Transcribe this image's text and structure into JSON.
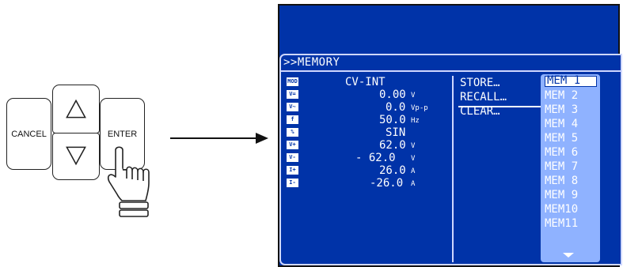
{
  "keypad": {
    "cancel_label": "CANCEL",
    "enter_label": "ENTER",
    "up_icon": "up-triangle-icon",
    "down_icon": "down-triangle-icon",
    "pointer_icon": "pointing-hand-icon"
  },
  "arrow_icon": "right-arrow-icon",
  "lcd": {
    "menu_title": ">>MEMORY",
    "params": [
      {
        "icon": "MOD",
        "value": "CV-INT",
        "unit": ""
      },
      {
        "icon": "V=",
        "value": "0.00",
        "unit": "V"
      },
      {
        "icon": "V~",
        "value": "0.0",
        "unit": "Vp-p"
      },
      {
        "icon": "f",
        "value": "50.0",
        "unit": "Hz"
      },
      {
        "icon": "%",
        "value": "SIN",
        "unit": ""
      },
      {
        "icon": "V+",
        "value": "62.0",
        "unit": "V"
      },
      {
        "icon": "V-",
        "value": "- 62.0",
        "unit": "V"
      },
      {
        "icon": "I+",
        "value": "26.0",
        "unit": "A"
      },
      {
        "icon": "I-",
        "value": "-26.0",
        "unit": "A"
      }
    ],
    "actions": [
      "STORE…",
      "RECALL…",
      "CLEAR…"
    ],
    "selected_action": "RECALL…",
    "memories": [
      "MEM 1",
      "MEM 2",
      "MEM 3",
      "MEM 4",
      "MEM 5",
      "MEM 6",
      "MEM 7",
      "MEM 8",
      "MEM 9",
      "MEM10",
      "MEM11"
    ],
    "selected_memory": "MEM 1",
    "colors": {
      "screen": "#0033a8",
      "list_panel": "#8fb2ff",
      "text": "#ffffff"
    }
  }
}
